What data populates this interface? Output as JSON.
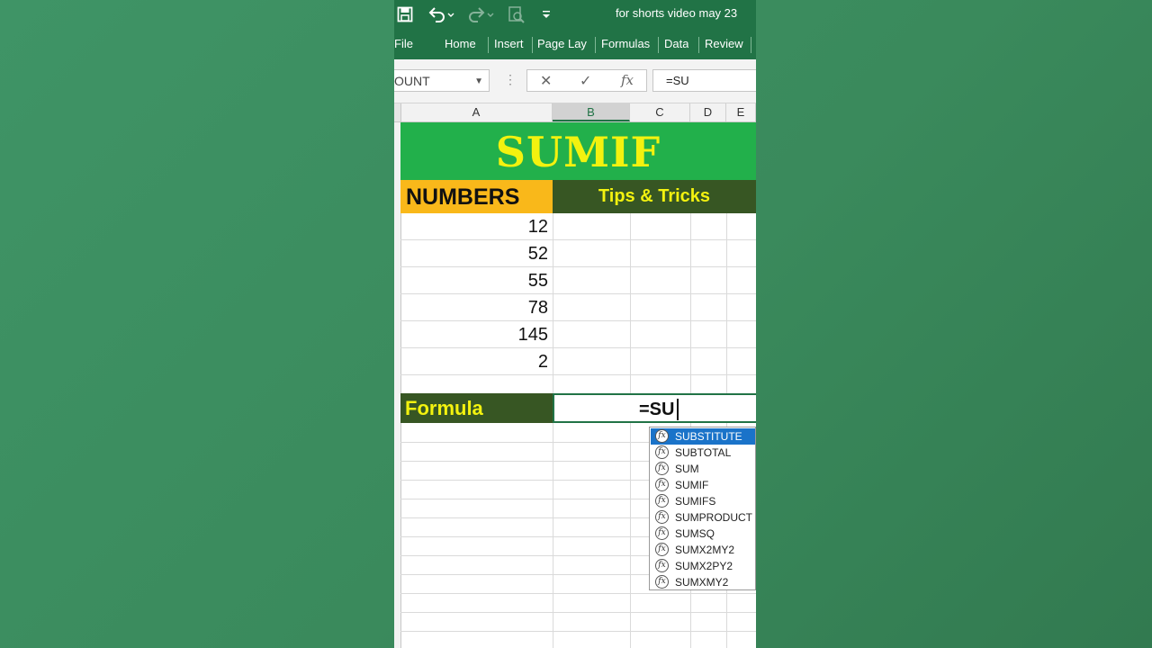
{
  "titlebar": {
    "document_title": "for shorts video may 23",
    "icons": [
      "save-icon",
      "undo-icon",
      "redo-icon",
      "print-preview-icon",
      "customize-qat-icon"
    ]
  },
  "ribbon": {
    "tabs": [
      "File",
      "Home",
      "Insert",
      "Page Lay",
      "Formulas",
      "Data",
      "Review"
    ]
  },
  "formula_bar": {
    "name_box": "OUNT",
    "cancel_symbol": "✕",
    "enter_symbol": "✓",
    "fx_symbol": "fx",
    "value": "=SU"
  },
  "columns": [
    "A",
    "B",
    "C",
    "D",
    "E"
  ],
  "sheet": {
    "title": "SUMIF",
    "header_left": "NUMBERS",
    "header_right": "Tips & Tricks",
    "numbers": [
      "12",
      "52",
      "55",
      "78",
      "145",
      "2"
    ],
    "formula_label": "Formula",
    "active_cell_text": "=SU"
  },
  "autocomplete": {
    "selected": "SUBSTITUTE",
    "items": [
      "SUBSTITUTE",
      "SUBTOTAL",
      "SUM",
      "SUMIF",
      "SUMIFS",
      "SUMPRODUCT",
      "SUMSQ",
      "SUMX2MY2",
      "SUMX2PY2",
      "SUMXMY2"
    ]
  },
  "colors": {
    "excel_green": "#217346",
    "title_fill": "#22b04b",
    "title_text": "#f3f20f",
    "numbers_fill": "#f9b81a",
    "dark_green_fill": "#375623"
  }
}
